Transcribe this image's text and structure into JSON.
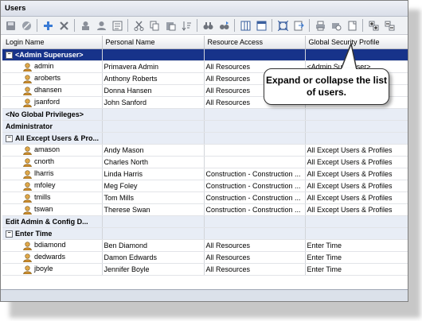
{
  "window": {
    "title": "Users"
  },
  "columns": [
    "Login Name",
    "Personal Name",
    "Resource Access",
    "Global Security Profile"
  ],
  "rows": [
    {
      "kind": "group",
      "toggle": "−",
      "label": "<Admin Superuser>",
      "selected": true
    },
    {
      "kind": "user",
      "login": "admin",
      "name": "Primavera Admin",
      "access": "All Resources",
      "profile": "<Admin Superuser>"
    },
    {
      "kind": "user",
      "login": "aroberts",
      "name": "Anthony Roberts",
      "access": "All Resources",
      "profile": ""
    },
    {
      "kind": "user",
      "login": "dhansen",
      "name": "Donna Hansen",
      "access": "All Resources",
      "profile": "D"
    },
    {
      "kind": "user",
      "login": "jsanford",
      "name": "John Sanford",
      "access": "All Resources",
      "profile": ""
    },
    {
      "kind": "group",
      "toggle": "",
      "label": "<No Global Privileges>"
    },
    {
      "kind": "group",
      "toggle": "",
      "label": "Administrator"
    },
    {
      "kind": "group",
      "toggle": "−",
      "label": "All Except Users & Pro..."
    },
    {
      "kind": "user",
      "login": "amason",
      "name": "Andy Mason",
      "access": "",
      "profile": "All Except Users & Profiles"
    },
    {
      "kind": "user",
      "login": "cnorth",
      "name": "Charles North",
      "access": "",
      "profile": "All Except Users & Profiles"
    },
    {
      "kind": "user",
      "login": "lharris",
      "name": "Linda Harris",
      "access": "Construction - Construction ...",
      "profile": "All Except Users & Profiles"
    },
    {
      "kind": "user",
      "login": "mfoley",
      "name": "Meg Foley",
      "access": "Construction - Construction ...",
      "profile": "All Except Users & Profiles"
    },
    {
      "kind": "user",
      "login": "tmills",
      "name": "Tom Mills",
      "access": "Construction - Construction ...",
      "profile": "All Except Users & Profiles"
    },
    {
      "kind": "user",
      "login": "tswan",
      "name": "Therese Swan",
      "access": "Construction - Construction ...",
      "profile": "All Except Users & Profiles"
    },
    {
      "kind": "group",
      "toggle": "",
      "label": "Edit Admin & Config D..."
    },
    {
      "kind": "group",
      "toggle": "−",
      "label": "Enter Time"
    },
    {
      "kind": "user",
      "login": "bdiamond",
      "name": "Ben Diamond",
      "access": "All Resources",
      "profile": "Enter Time"
    },
    {
      "kind": "user",
      "login": "dedwards",
      "name": "Damon Edwards",
      "access": "All Resources",
      "profile": "Enter Time"
    },
    {
      "kind": "user",
      "login": "jboyle",
      "name": "Jennifer Boyle",
      "access": "All Resources",
      "profile": "Enter Time"
    }
  ],
  "callout": {
    "text": "Expand or collapse the list of users."
  },
  "colors": {
    "selected_row": "#17338a",
    "group_row": "#e8edf6"
  }
}
